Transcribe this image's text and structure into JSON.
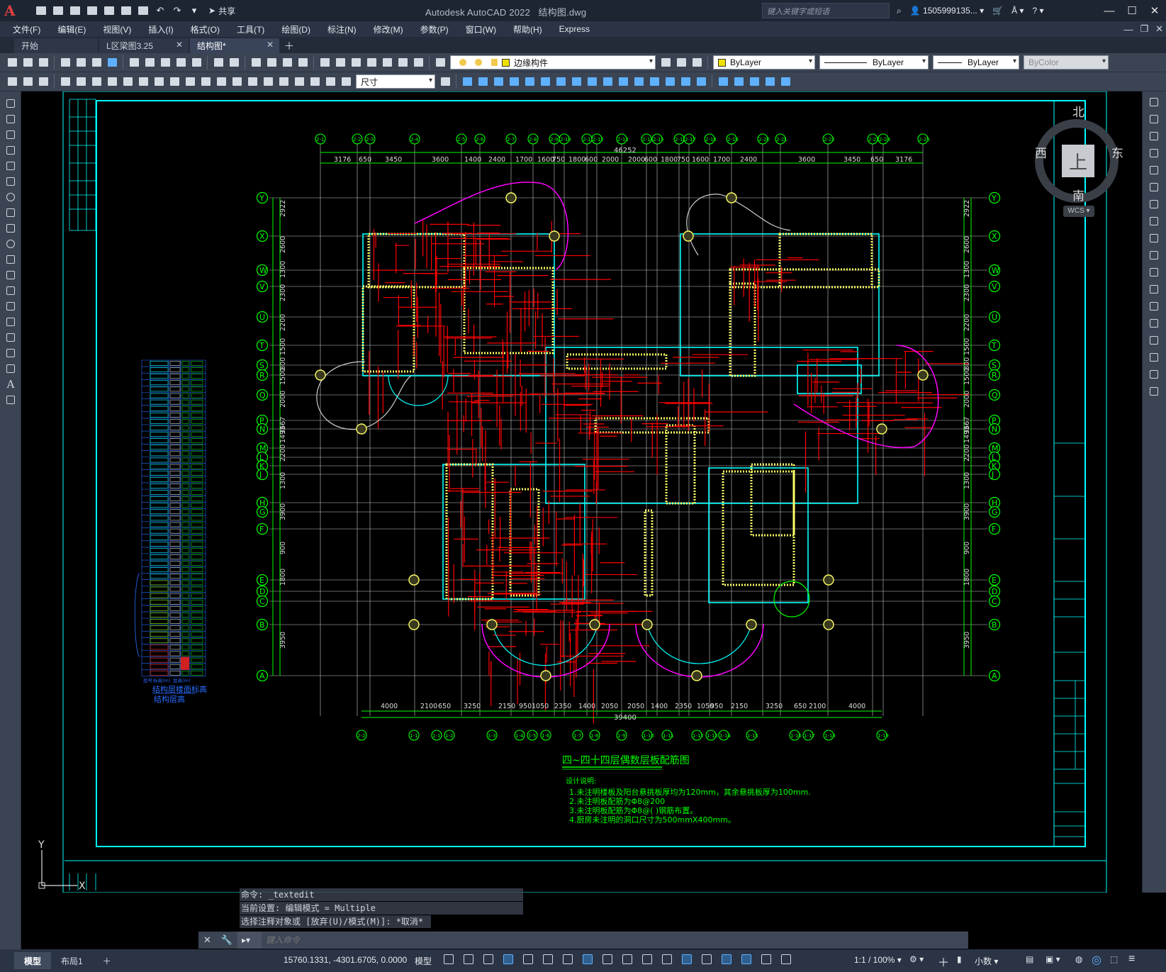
{
  "titlebar": {
    "app_title": "Autodesk AutoCAD 2022",
    "file_name": "结构图.dwg",
    "share_label": "共享",
    "search_placeholder": "键入关键字或短语",
    "user": "1505999135...",
    "app_letter": "A"
  },
  "menu": [
    "文件(F)",
    "编辑(E)",
    "视图(V)",
    "插入(I)",
    "格式(O)",
    "工具(T)",
    "绘图(D)",
    "标注(N)",
    "修改(M)",
    "参数(P)",
    "窗口(W)",
    "帮助(H)",
    "Express"
  ],
  "tabs": [
    {
      "label": "开始",
      "active": false,
      "closable": false
    },
    {
      "label": "L区梁图3.25",
      "active": false,
      "closable": true
    },
    {
      "label": "结构图*",
      "active": true,
      "closable": true
    }
  ],
  "properties": {
    "layer": "边缘构件",
    "color": "ByLayer",
    "linetype": "ByLayer",
    "lineweight": "ByLayer",
    "plotstyle": "ByColor",
    "dim_style": "尺寸"
  },
  "viewcube": {
    "north": "北",
    "south": "南",
    "east": "东",
    "west": "西",
    "top": "上",
    "wcs": "WCS"
  },
  "drawing": {
    "plan_title": "四~四十四层偶数层板配筋图",
    "total_dim_top": "46252",
    "total_dim_bottom": "39400",
    "notes_title": "设计说明:",
    "notes": [
      "1.未注明楼板及阳台悬挑板厚均为120mm，其余悬挑板厚为100mm.",
      "2.未注明板配筋为Φ8@200",
      "3.未注明板配筋为Φ8@(   )钢筋布置。",
      "4.厨房未注明的洞口尺寸为500mmX400mm。"
    ],
    "row_axes": [
      "Y",
      "X",
      "W",
      "V",
      "U",
      "T",
      "S",
      "R",
      "Q",
      "P",
      "N",
      "M",
      "L",
      "K",
      "J",
      "H",
      "G",
      "F",
      "E",
      "D",
      "C",
      "B",
      "A"
    ],
    "top_axes": [
      "2-1",
      "2-2",
      "2-3",
      "2-4",
      "2-5",
      "2-6",
      "2-7",
      "2-8",
      "2-9",
      "2-10",
      "2-11",
      "2-12",
      "2-13",
      "2-14",
      "2-15",
      "2-16",
      "2-17",
      "2-18",
      "2-19",
      "2-20",
      "2-21",
      "2-22",
      "2-23",
      "2-24",
      "2-25",
      "2-26",
      "2-27"
    ],
    "top_dims": [
      "3176",
      "650",
      "3450",
      "3600",
      "1400",
      "2400",
      "1700",
      "1600",
      "750",
      "1800",
      "600",
      "2000",
      "2000",
      "600",
      "1800",
      "750",
      "1600",
      "1700",
      "2400",
      "3600",
      "3450",
      "650",
      "3176"
    ],
    "bottom_dims": [
      "4000",
      "2100",
      "650",
      "3250",
      "2150",
      "950",
      "1050",
      "2350",
      "1400",
      "2050",
      "2050",
      "1400",
      "2350",
      "1050",
      "950",
      "2150",
      "3250",
      "650",
      "2100",
      "4000"
    ],
    "bottom_axes": [
      "2-2",
      "1-1",
      "1-1",
      "1-2",
      "1-3",
      "1-4",
      "1-5",
      "1-6",
      "1-7",
      "1-8",
      "1-9",
      "1-10",
      "1-11",
      "1-12",
      "1-13",
      "1-14",
      "1-15",
      "1-16",
      "1-17",
      "1-18",
      "1-19",
      "1-20"
    ],
    "left_dims": [
      "2922",
      "2600",
      "1300",
      "2300",
      "2200",
      "1500",
      "800",
      "1500",
      "2000",
      "3667",
      "1493",
      "2200",
      "1300",
      "3900",
      "900",
      "1800",
      "3950"
    ],
    "level_table_title": "结构层楼面标高",
    "level_table_sub": "结构层高",
    "level_table_header": [
      "层号",
      "标高(m)",
      "层高(m)"
    ]
  },
  "command": {
    "history": [
      "命令: _textedit",
      "当前设置: 编辑模式 = Multiple",
      "选择注释对象或 [放弃(U)/模式(M)]: *取消*"
    ],
    "placeholder": "键入命令"
  },
  "statusbar": {
    "layout_tabs": [
      "模型",
      "布局1"
    ],
    "coordinates": "15760.1331, -4301.6705, 0.0000",
    "space": "模型",
    "scale": "1:1 / 100%",
    "units": "小数"
  },
  "colors": {
    "grid": "#00ff00",
    "wall_hatch": "#ffff66",
    "rebar": "#ff0000",
    "curve": "#ff00ff",
    "cyan_line": "#00ffff",
    "frame": "#00ffff"
  }
}
